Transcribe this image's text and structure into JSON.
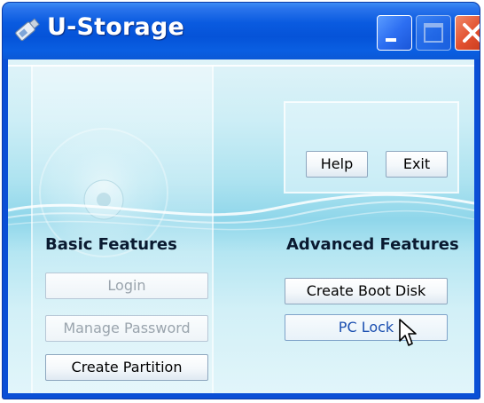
{
  "window": {
    "title": "U-Storage",
    "controls": {
      "minimize": "minimize",
      "maximize": "maximize",
      "close": "close"
    }
  },
  "top_panel": {
    "help_label": "Help",
    "exit_label": "Exit"
  },
  "basic": {
    "heading": "Basic Features",
    "buttons": [
      {
        "label": "Login",
        "enabled": false
      },
      {
        "label": "Manage Password",
        "enabled": false
      },
      {
        "label": "Create Partition",
        "enabled": true
      }
    ]
  },
  "advanced": {
    "heading": "Advanced Features",
    "buttons": [
      {
        "label": "Create Boot Disk",
        "enabled": true
      },
      {
        "label": "PC Lock",
        "enabled": true
      }
    ]
  },
  "icons": {
    "app": "usb-drive-icon",
    "pointer": "mouse-pointer-icon"
  },
  "colors": {
    "titlebar": "#0553d8",
    "close_button": "#e2502f",
    "client_background": "#aee3f0",
    "disabled_text": "#9aa4ad",
    "focused_text": "#1b4fb0"
  }
}
